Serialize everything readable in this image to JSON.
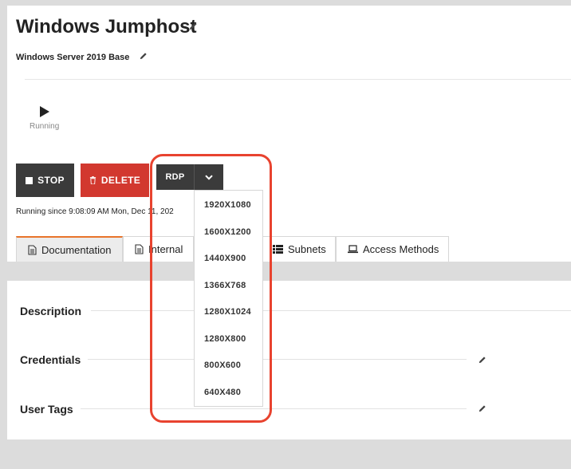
{
  "header": {
    "title": "Windows Jumphost",
    "subtitle": "Windows Server 2019 Base"
  },
  "status": {
    "label": "Running",
    "since": "Running since 9:08:09 AM Mon, Dec 11, 202"
  },
  "actions": {
    "stop_label": "STOP",
    "delete_label": "DELETE",
    "rdp_label": "RDP"
  },
  "resolution_menu": {
    "items": [
      "1920X1080",
      "1600X1200",
      "1440X900",
      "1366X768",
      "1280X1024",
      "1280X800",
      "800X600",
      "640X480"
    ]
  },
  "tabs": [
    {
      "label": "Documentation",
      "icon": "document-icon",
      "active": true
    },
    {
      "label": "Internal",
      "icon": "document-icon",
      "active": false
    },
    {
      "label": "Subnets",
      "icon": "list-icon",
      "active": false
    },
    {
      "label": "Access Methods",
      "icon": "laptop-icon",
      "active": false
    }
  ],
  "sections": {
    "description": "Description",
    "credentials": "Credentials",
    "user_tags": "User Tags"
  },
  "colors": {
    "delete": "#d2382f",
    "dark_button": "#3b3b3b",
    "active_tab_accent": "#e8742a",
    "highlight": "#e8432f"
  }
}
